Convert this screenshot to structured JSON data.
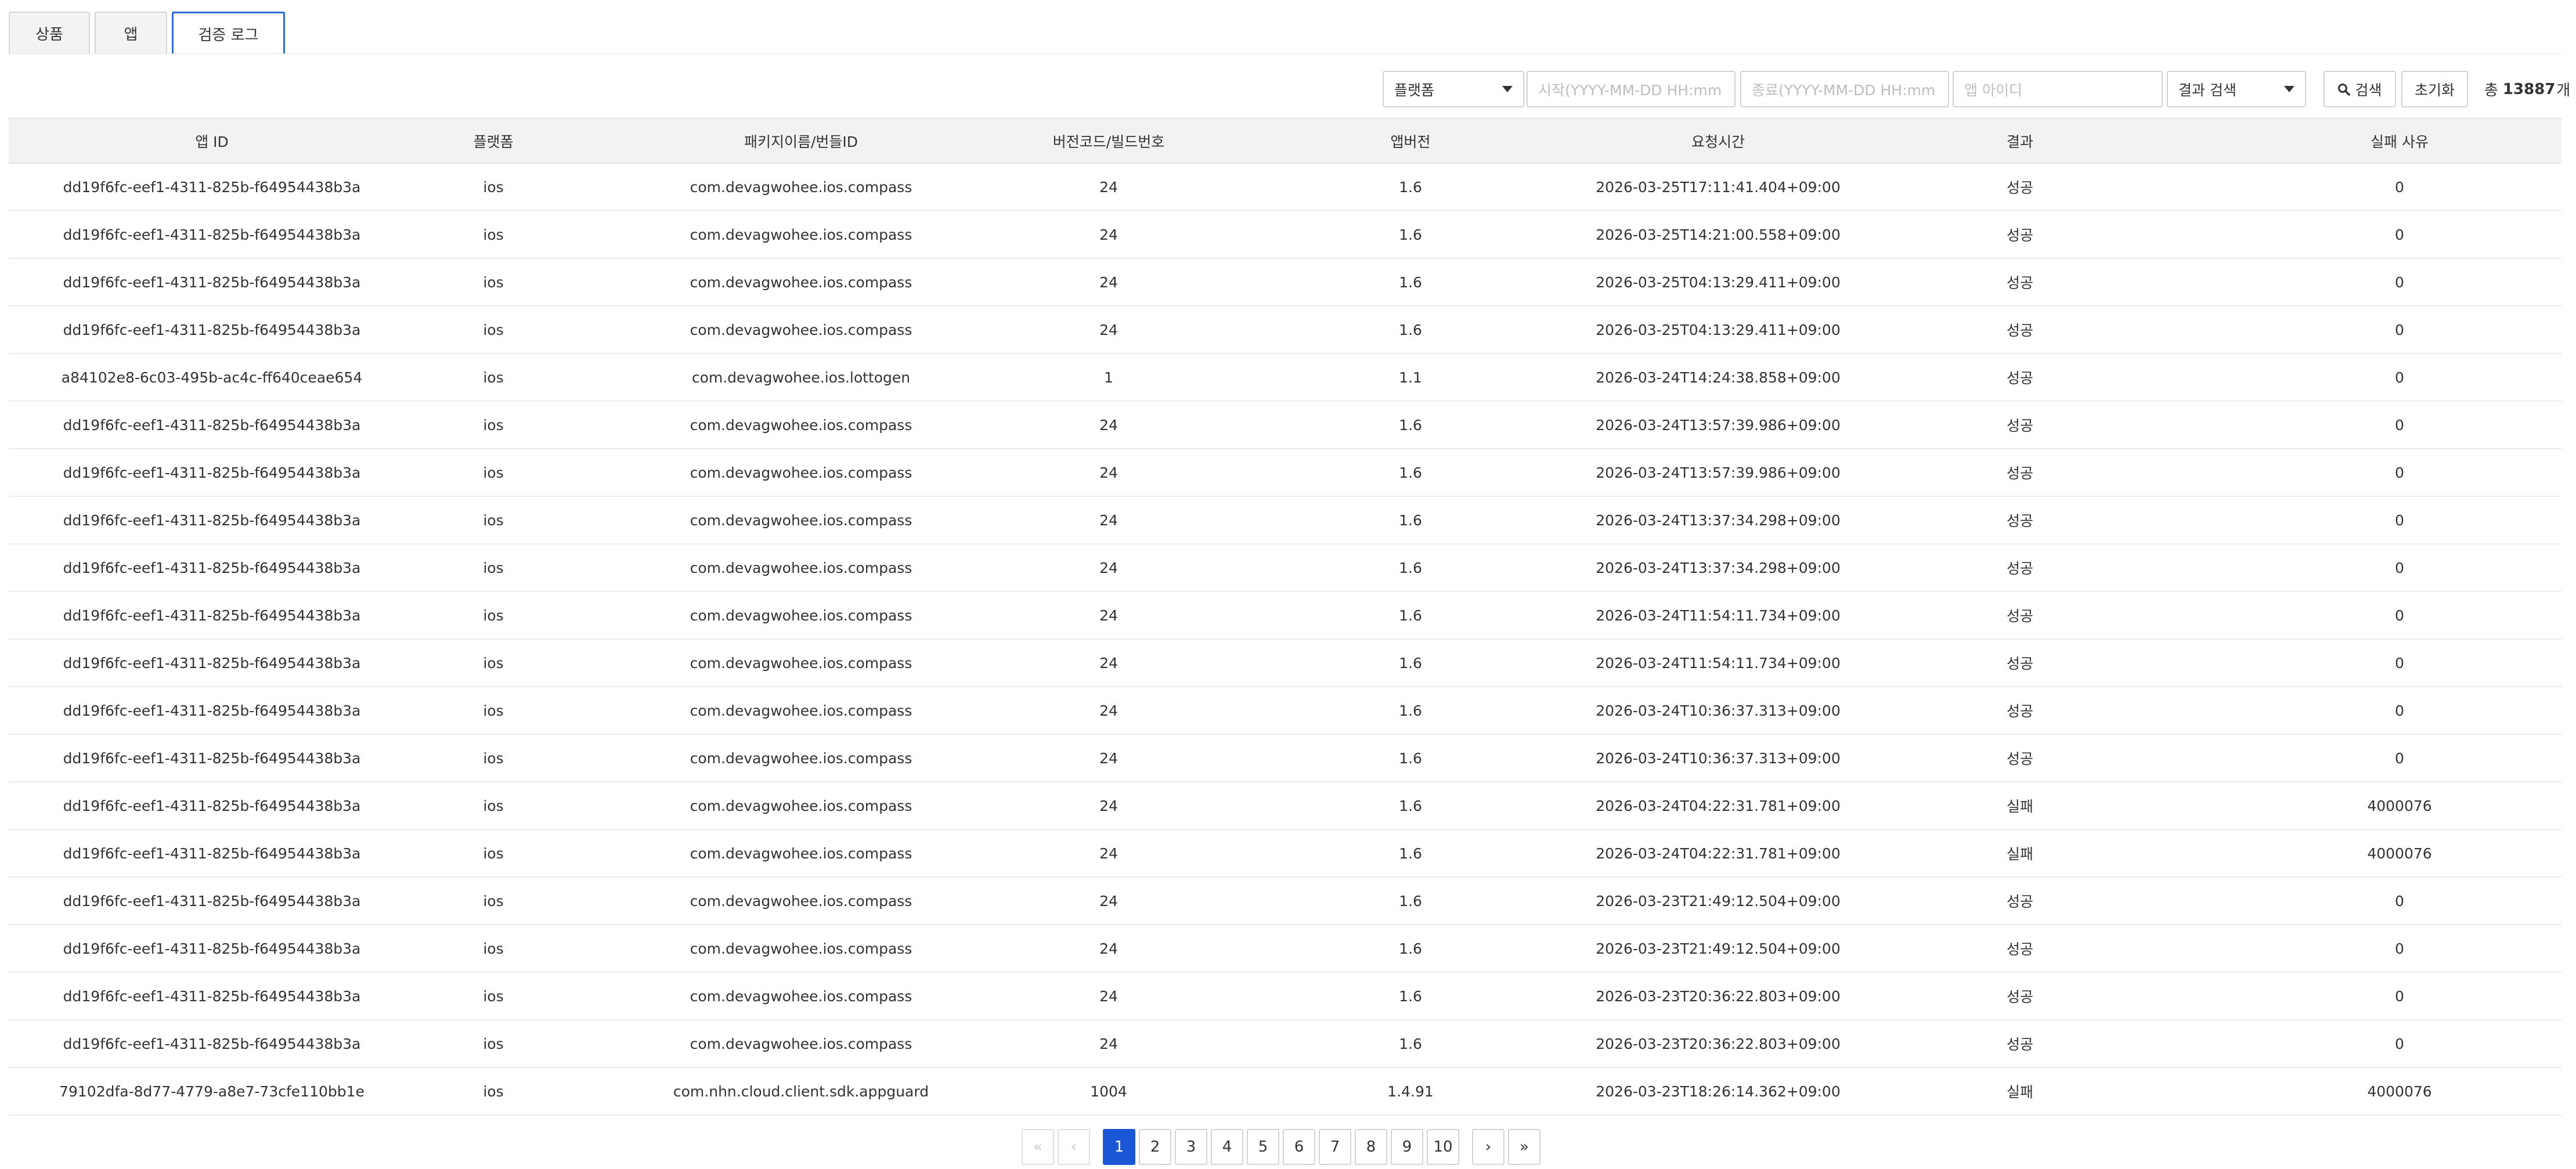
{
  "tabs": [
    {
      "label": "상품"
    },
    {
      "label": "앱"
    },
    {
      "label": "검증 로그"
    }
  ],
  "filters": {
    "platform_select": "플랫폼",
    "start_placeholder": "시작(YYYY-MM-DD HH:mm",
    "end_placeholder": "종료(YYYY-MM-DD HH:mm",
    "app_id_placeholder": "앱 아이디",
    "result_select": "결과 검색",
    "search_label": "검색",
    "reset_label": "초기화",
    "total_prefix": "총",
    "total_count": "13887",
    "total_suffix": "개"
  },
  "table": {
    "headers": [
      "앱 ID",
      "플랫폼",
      "패키지이름/번들ID",
      "버전코드/빌드번호",
      "앱버전",
      "요청시간",
      "결과",
      "실패 사유"
    ],
    "rows": [
      [
        "dd19f6fc-eef1-4311-825b-f64954438b3a",
        "ios",
        "com.devagwohee.ios.compass",
        "24",
        "1.6",
        "2026-03-25T17:11:41.404+09:00",
        "성공",
        "0"
      ],
      [
        "dd19f6fc-eef1-4311-825b-f64954438b3a",
        "ios",
        "com.devagwohee.ios.compass",
        "24",
        "1.6",
        "2026-03-25T14:21:00.558+09:00",
        "성공",
        "0"
      ],
      [
        "dd19f6fc-eef1-4311-825b-f64954438b3a",
        "ios",
        "com.devagwohee.ios.compass",
        "24",
        "1.6",
        "2026-03-25T04:13:29.411+09:00",
        "성공",
        "0"
      ],
      [
        "dd19f6fc-eef1-4311-825b-f64954438b3a",
        "ios",
        "com.devagwohee.ios.compass",
        "24",
        "1.6",
        "2026-03-25T04:13:29.411+09:00",
        "성공",
        "0"
      ],
      [
        "a84102e8-6c03-495b-ac4c-ff640ceae654",
        "ios",
        "com.devagwohee.ios.lottogen",
        "1",
        "1.1",
        "2026-03-24T14:24:38.858+09:00",
        "성공",
        "0"
      ],
      [
        "dd19f6fc-eef1-4311-825b-f64954438b3a",
        "ios",
        "com.devagwohee.ios.compass",
        "24",
        "1.6",
        "2026-03-24T13:57:39.986+09:00",
        "성공",
        "0"
      ],
      [
        "dd19f6fc-eef1-4311-825b-f64954438b3a",
        "ios",
        "com.devagwohee.ios.compass",
        "24",
        "1.6",
        "2026-03-24T13:57:39.986+09:00",
        "성공",
        "0"
      ],
      [
        "dd19f6fc-eef1-4311-825b-f64954438b3a",
        "ios",
        "com.devagwohee.ios.compass",
        "24",
        "1.6",
        "2026-03-24T13:37:34.298+09:00",
        "성공",
        "0"
      ],
      [
        "dd19f6fc-eef1-4311-825b-f64954438b3a",
        "ios",
        "com.devagwohee.ios.compass",
        "24",
        "1.6",
        "2026-03-24T13:37:34.298+09:00",
        "성공",
        "0"
      ],
      [
        "dd19f6fc-eef1-4311-825b-f64954438b3a",
        "ios",
        "com.devagwohee.ios.compass",
        "24",
        "1.6",
        "2026-03-24T11:54:11.734+09:00",
        "성공",
        "0"
      ],
      [
        "dd19f6fc-eef1-4311-825b-f64954438b3a",
        "ios",
        "com.devagwohee.ios.compass",
        "24",
        "1.6",
        "2026-03-24T11:54:11.734+09:00",
        "성공",
        "0"
      ],
      [
        "dd19f6fc-eef1-4311-825b-f64954438b3a",
        "ios",
        "com.devagwohee.ios.compass",
        "24",
        "1.6",
        "2026-03-24T10:36:37.313+09:00",
        "성공",
        "0"
      ],
      [
        "dd19f6fc-eef1-4311-825b-f64954438b3a",
        "ios",
        "com.devagwohee.ios.compass",
        "24",
        "1.6",
        "2026-03-24T10:36:37.313+09:00",
        "성공",
        "0"
      ],
      [
        "dd19f6fc-eef1-4311-825b-f64954438b3a",
        "ios",
        "com.devagwohee.ios.compass",
        "24",
        "1.6",
        "2026-03-24T04:22:31.781+09:00",
        "실패",
        "4000076"
      ],
      [
        "dd19f6fc-eef1-4311-825b-f64954438b3a",
        "ios",
        "com.devagwohee.ios.compass",
        "24",
        "1.6",
        "2026-03-24T04:22:31.781+09:00",
        "실패",
        "4000076"
      ],
      [
        "dd19f6fc-eef1-4311-825b-f64954438b3a",
        "ios",
        "com.devagwohee.ios.compass",
        "24",
        "1.6",
        "2026-03-23T21:49:12.504+09:00",
        "성공",
        "0"
      ],
      [
        "dd19f6fc-eef1-4311-825b-f64954438b3a",
        "ios",
        "com.devagwohee.ios.compass",
        "24",
        "1.6",
        "2026-03-23T21:49:12.504+09:00",
        "성공",
        "0"
      ],
      [
        "dd19f6fc-eef1-4311-825b-f64954438b3a",
        "ios",
        "com.devagwohee.ios.compass",
        "24",
        "1.6",
        "2026-03-23T20:36:22.803+09:00",
        "성공",
        "0"
      ],
      [
        "dd19f6fc-eef1-4311-825b-f64954438b3a",
        "ios",
        "com.devagwohee.ios.compass",
        "24",
        "1.6",
        "2026-03-23T20:36:22.803+09:00",
        "성공",
        "0"
      ],
      [
        "79102dfa-8d77-4779-a8e7-73cfe110bb1e",
        "ios",
        "com.nhn.cloud.client.sdk.appguard",
        "1004",
        "1.4.91",
        "2026-03-23T18:26:14.362+09:00",
        "실패",
        "4000076"
      ]
    ]
  },
  "pagination": {
    "first": "«",
    "prev": "‹",
    "pages": [
      "1",
      "2",
      "3",
      "4",
      "5",
      "6",
      "7",
      "8",
      "9",
      "10"
    ],
    "current": "1",
    "next": "›",
    "last": "»"
  },
  "icons": {
    "search": "search-icon",
    "caret": "chevron-down-icon"
  },
  "colors": {
    "accent": "#1a56d6",
    "active_tab_border": "#2b6cd4"
  }
}
